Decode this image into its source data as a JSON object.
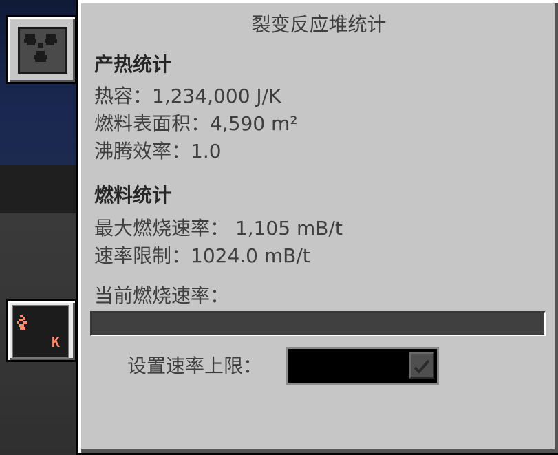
{
  "window": {
    "title": "裂变反应堆统计"
  },
  "heat_section": {
    "heading": "产热统计",
    "heat_capacity": "热容：1,234,000 J/K",
    "fuel_surface_area": "燃料表面积：4,590 m²",
    "boil_efficiency": "沸腾效率：1.0"
  },
  "fuel_section": {
    "heading": "燃料统计",
    "max_burn_rate": "最大燃烧速率： 1,105 mB/t",
    "rate_limit": "速率限制：1024.0 mB/t",
    "current_burn_rate_label": "当前燃烧速率："
  },
  "burn_rate_bar": {
    "fill_percent": 0,
    "fill_color": "#5fd35f",
    "track_color": "#404040"
  },
  "rate_limit_control": {
    "label": "设置速率上限：",
    "value": "",
    "confirm_icon": "checkmark-icon"
  },
  "side_tabs": [
    {
      "icon": "radiation-icon"
    },
    {
      "icon": "heat-icon",
      "badge": "K"
    }
  ],
  "colors": {
    "panel": "#c6c6c6",
    "text": "#3f3f3f",
    "heading": "#262626"
  }
}
